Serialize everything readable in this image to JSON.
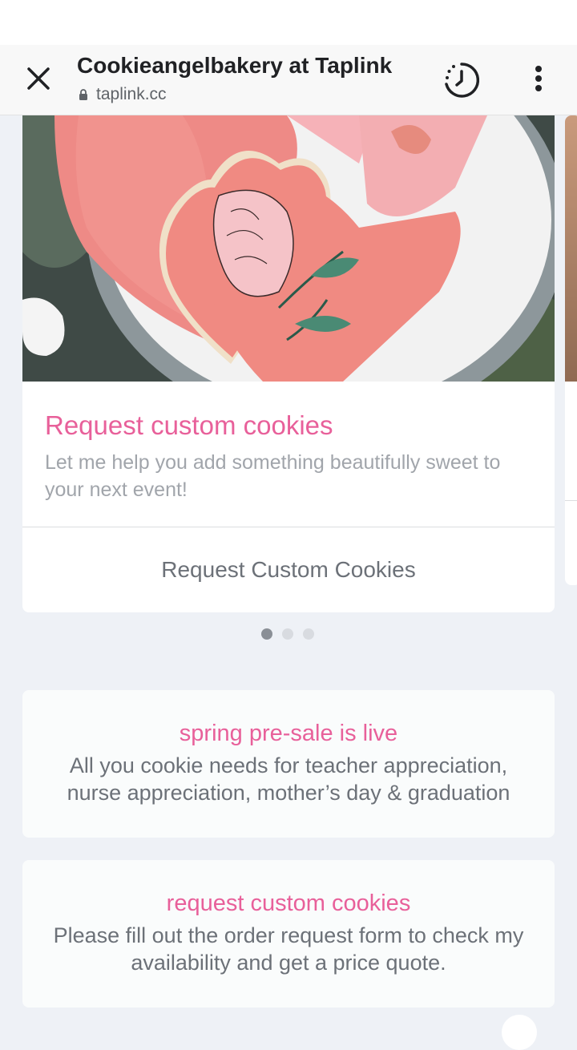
{
  "browser": {
    "title": "Cookieangelbakery at Taplink",
    "url": "taplink.cc",
    "icons": {
      "close": "close-icon",
      "lock": "lock-icon",
      "history": "history-icon",
      "menu": "more-vert-icon"
    }
  },
  "carousel": {
    "card": {
      "title": "Request custom cookies",
      "description": "Let me help you add something beautifully sweet to your next event!",
      "button_label": "Request Custom Cookies"
    },
    "pages": 3,
    "active_page": 1
  },
  "blocks": [
    {
      "title": "spring pre-sale is live",
      "text": "All you cookie needs for teacher appreciation, nurse appreciation, mother’s day & graduation"
    },
    {
      "title": "request custom cookies",
      "text": "Please fill out the order request form to check my availability and get a price quote."
    }
  ],
  "colors": {
    "accent": "#e8609a",
    "muted_text": "#a1a5ab",
    "body_text": "#6c7178",
    "page_bg": "#eef1f6"
  }
}
